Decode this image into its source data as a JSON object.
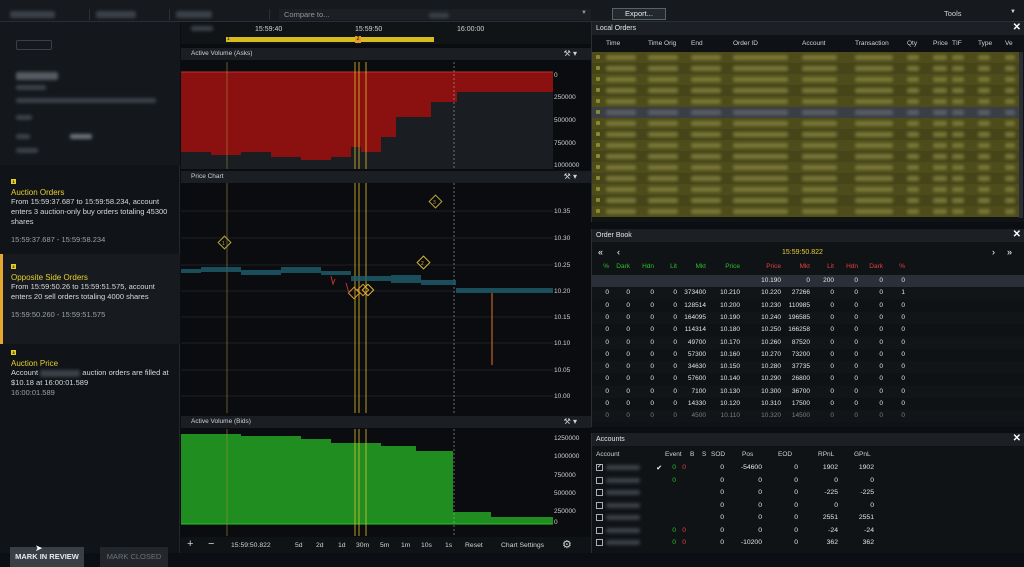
{
  "topbar": {
    "compare_placeholder": "Compare to...",
    "export_label": "Export...",
    "tools_label": "Tools"
  },
  "alerts": [
    {
      "num": "1",
      "title": "Auction Orders",
      "desc": "From 15:59:37.687 to 15:59:58.234, account enters 3 auction-only buy orders totaling 45300 shares",
      "time": "15:59:37.687 - 15:59:58.234"
    },
    {
      "num": "2",
      "title": "Opposite Side Orders",
      "desc": "From 15:59:50.26 to 15:59:51.575, account enters 20 sell orders totaling 4000 shares",
      "time": "15:59:50.260 - 15:59:51.575"
    },
    {
      "num": "3",
      "title": "Auction Price",
      "desc_pre": "Account",
      "desc_post": "auction orders are filled at $10.18 at 16:00:01.589",
      "time": "16:00:01.589"
    }
  ],
  "buttons": {
    "mark_review": "MARK IN REVIEW",
    "mark_closed": "MARK CLOSED"
  },
  "timeline": {
    "ticks": [
      "15:59:40",
      "15:59:50",
      "16:00:00"
    ],
    "markers": [
      "1",
      "2"
    ]
  },
  "panels": {
    "asks_title": "Active Volume (Asks)",
    "price_title": "Price Chart",
    "bids_title": "Active Volume (Bids)",
    "asks_y": [
      "0",
      "250000",
      "500000",
      "750000",
      "1000000"
    ],
    "price_y": [
      "10.35",
      "10.30",
      "10.25",
      "10.20",
      "10.15",
      "10.10",
      "10.05",
      "10.00"
    ],
    "bids_y": [
      "1250000",
      "1000000",
      "750000",
      "500000",
      "250000",
      "0"
    ],
    "price_markers": [
      "1",
      "2",
      "3"
    ]
  },
  "bottom_bar": {
    "plus": "+",
    "minus": "−",
    "time": "15:59:50.822",
    "ranges": [
      "5d",
      "2d",
      "1d",
      "30m",
      "5m",
      "1m",
      "10s",
      "1s"
    ],
    "reset": "Reset",
    "settings": "Chart Settings"
  },
  "local_orders": {
    "title": "Local Orders",
    "columns": [
      "Time",
      "Time Orig",
      "End",
      "Order ID",
      "Account",
      "Transaction",
      "Qty",
      "Price",
      "TIF",
      "Type",
      "Ve"
    ]
  },
  "order_book": {
    "title": "Order Book",
    "time": "15:59:50.822",
    "columns_left": [
      "%",
      "Dark",
      "Hdn",
      "Lit",
      "Mkt",
      "Price"
    ],
    "columns_right": [
      "Price",
      "Mkt",
      "Lit",
      "Hdn",
      "Dark",
      "%"
    ],
    "rows": [
      [
        "",
        "",
        "",
        "",
        "",
        "",
        "10.190",
        "0",
        "200",
        "0",
        "0",
        "0"
      ],
      [
        "0",
        "0",
        "0",
        "0",
        "373400",
        "10.210",
        "10.220",
        "27266",
        "0",
        "0",
        "0",
        "1"
      ],
      [
        "0",
        "0",
        "0",
        "0",
        "128514",
        "10.200",
        "10.230",
        "110985",
        "0",
        "0",
        "0",
        "0"
      ],
      [
        "0",
        "0",
        "0",
        "0",
        "164095",
        "10.190",
        "10.240",
        "196585",
        "0",
        "0",
        "0",
        "0"
      ],
      [
        "0",
        "0",
        "0",
        "0",
        "114314",
        "10.180",
        "10.250",
        "166258",
        "0",
        "0",
        "0",
        "0"
      ],
      [
        "0",
        "0",
        "0",
        "0",
        "49700",
        "10.170",
        "10.260",
        "87520",
        "0",
        "0",
        "0",
        "0"
      ],
      [
        "0",
        "0",
        "0",
        "0",
        "57300",
        "10.160",
        "10.270",
        "73200",
        "0",
        "0",
        "0",
        "0"
      ],
      [
        "0",
        "0",
        "0",
        "0",
        "34630",
        "10.150",
        "10.280",
        "37735",
        "0",
        "0",
        "0",
        "0"
      ],
      [
        "0",
        "0",
        "0",
        "0",
        "57600",
        "10.140",
        "10.290",
        "26800",
        "0",
        "0",
        "0",
        "0"
      ],
      [
        "0",
        "0",
        "0",
        "0",
        "7100",
        "10.130",
        "10.300",
        "36700",
        "0",
        "0",
        "0",
        "0"
      ],
      [
        "0",
        "0",
        "0",
        "0",
        "14330",
        "10.120",
        "10.310",
        "17500",
        "0",
        "0",
        "0",
        "0"
      ],
      [
        "0",
        "0",
        "0",
        "0",
        "4500",
        "10.110",
        "10.320",
        "14500",
        "0",
        "0",
        "0",
        "0"
      ]
    ]
  },
  "accounts": {
    "title": "Accounts",
    "columns": [
      "Account",
      "Event",
      "B",
      "S",
      "SOD",
      "Pos",
      "EOD",
      "RPnL",
      "GPnL"
    ],
    "rows": [
      {
        "checked": true,
        "event": "✔",
        "b": "0",
        "s": "0",
        "sod": "0",
        "pos": "-54600",
        "eod": "0",
        "rpnl": "1902",
        "gpnl": "1902"
      },
      {
        "checked": false,
        "event": "",
        "b": "0",
        "s": "",
        "sod": "0",
        "pos": "0",
        "eod": "0",
        "rpnl": "0",
        "gpnl": "0"
      },
      {
        "checked": false,
        "event": "",
        "b": "",
        "s": "",
        "sod": "0",
        "pos": "0",
        "eod": "0",
        "rpnl": "-225",
        "gpnl": "-225"
      },
      {
        "checked": false,
        "event": "",
        "b": "",
        "s": "",
        "sod": "0",
        "pos": "0",
        "eod": "0",
        "rpnl": "0",
        "gpnl": "0"
      },
      {
        "checked": false,
        "event": "",
        "b": "",
        "s": "",
        "sod": "0",
        "pos": "0",
        "eod": "0",
        "rpnl": "2551",
        "gpnl": "2551"
      },
      {
        "checked": false,
        "event": "",
        "b": "0",
        "s": "0",
        "sod": "0",
        "pos": "0",
        "eod": "0",
        "rpnl": "-24",
        "gpnl": "-24"
      },
      {
        "checked": false,
        "event": "",
        "b": "0",
        "s": "0",
        "sod": "0",
        "pos": "-10200",
        "eod": "0",
        "rpnl": "362",
        "gpnl": "362"
      }
    ]
  },
  "colors": {
    "ask": "#8b1010",
    "bid": "#1f8d1f",
    "accent": "#e6cd29",
    "lo_row": "#4d4c1a"
  }
}
